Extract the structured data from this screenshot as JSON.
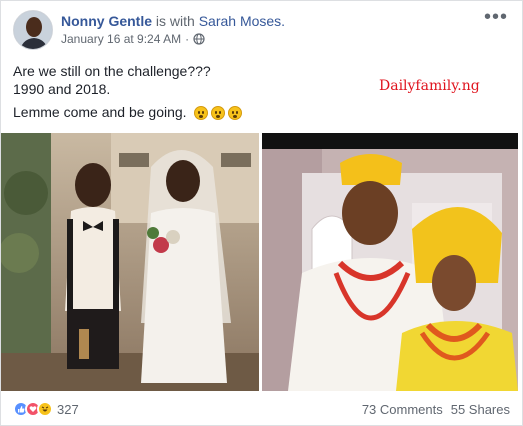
{
  "post": {
    "author": "Nonny Gentle",
    "with_text": "is with",
    "tagged": "Sarah Moses.",
    "timestamp": "January 16 at 9:24 AM",
    "separator": "·",
    "privacy_icon": "globe-icon",
    "more_icon": "more-options-icon",
    "more_glyph": "•••",
    "lines": [
      "Are we still on the challenge???",
      "1990 and 2018.",
      "Lemme come and be going."
    ],
    "emoji_icon": "grinning-face-emoji-icon",
    "watermark": "Dailyfamily.ng"
  },
  "footer": {
    "reactions": [
      "like-reaction-icon",
      "love-reaction-icon",
      "haha-reaction-icon"
    ],
    "reaction_count": "327",
    "comments": "73 Comments",
    "shares": "55 Shares"
  },
  "colors": {
    "link": "#365899",
    "meta": "#606770",
    "watermark": "#e0141e",
    "like": "#5890ff",
    "love": "#f25268",
    "haha": "#f7c21b"
  }
}
